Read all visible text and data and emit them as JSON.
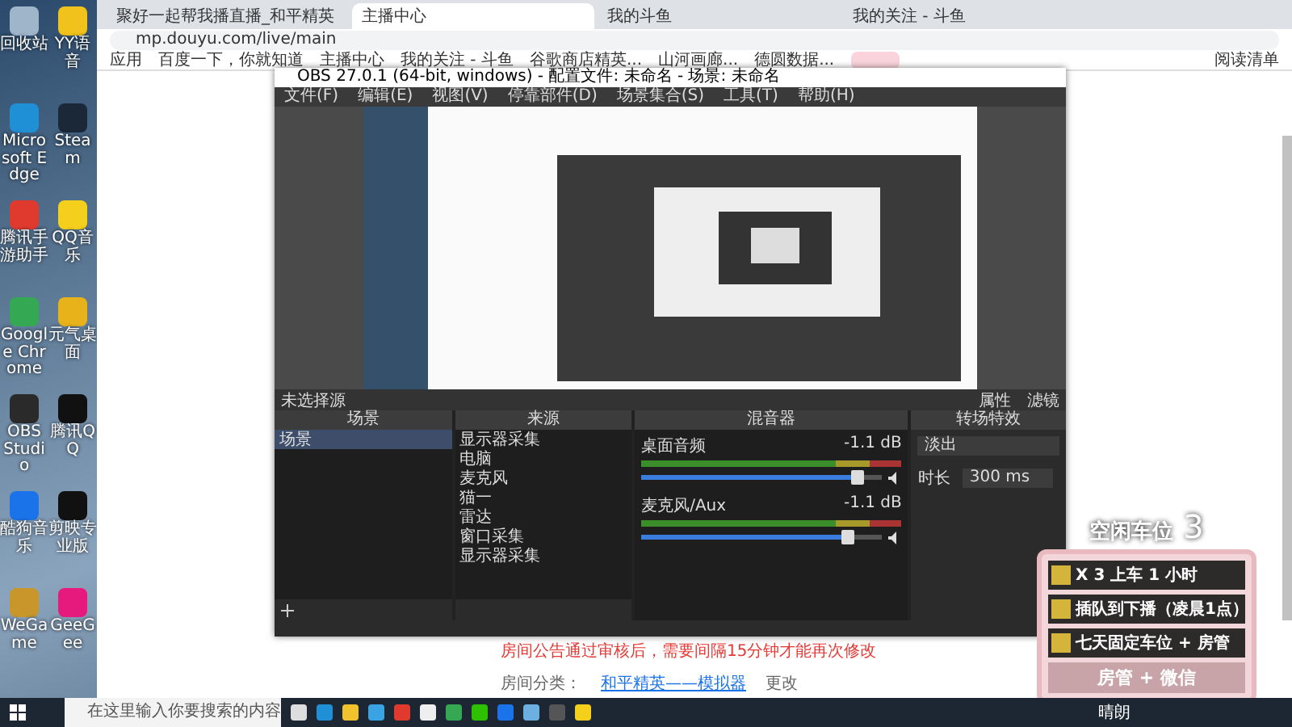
{
  "desktop_icons": [
    {
      "label": "回收站"
    },
    {
      "label": "YY语音"
    },
    {
      "label": "Microsoft Edge"
    },
    {
      "label": "Steam"
    },
    {
      "label": "腾讯手游助手"
    },
    {
      "label": "QQ音乐"
    },
    {
      "label": "Google Chrome"
    },
    {
      "label": "元气桌面"
    },
    {
      "label": "OBS Studio"
    },
    {
      "label": "腾讯QQ"
    },
    {
      "label": "酷狗音乐"
    },
    {
      "label": "剪映专业版"
    },
    {
      "label": "WeGame"
    },
    {
      "label": "GeeGee"
    }
  ],
  "browser": {
    "tabs": [
      {
        "label": "聚好一起帮我播直播_和平精英",
        "selected": false
      },
      {
        "label": "主播中心",
        "selected": true
      },
      {
        "label": "我的斗鱼",
        "selected": false
      },
      {
        "label": "我的关注 - 斗鱼",
        "selected": false
      }
    ],
    "url": "mp.douyu.com/live/main",
    "bookmarks": [
      {
        "label": "应用"
      },
      {
        "label": "百度一下，你就知道"
      },
      {
        "label": "主播中心"
      },
      {
        "label": "我的关注 - 斗鱼"
      },
      {
        "label": "谷歌商店精英..."
      },
      {
        "label": "山河画廊..."
      },
      {
        "label": "德圆数据..."
      }
    ],
    "reading_list": "阅读清单",
    "page": {
      "notice": "房间公告通过审核后，需要间隔15分钟才能再次修改",
      "category_label": "房间分类：",
      "category_value": "和平精英——模拟器",
      "change_link": "更改"
    }
  },
  "obs": {
    "title": "OBS 27.0.1 (64-bit, windows) - 配置文件: 未命名 - 场景: 未命名",
    "menu": [
      "文件(F)",
      "编辑(E)",
      "视图(V)",
      "停靠部件(D)",
      "场景集合(S)",
      "工具(T)",
      "帮助(H)"
    ],
    "no_source": "未选择源",
    "properties_button": "属性",
    "filters_button": "滤镜",
    "scenes": {
      "title": "场景",
      "items": [
        {
          "label": "场景",
          "selected": true
        }
      ]
    },
    "sources": {
      "title": "来源",
      "items": [
        {
          "label": "显示器采集"
        },
        {
          "label": "电脑"
        },
        {
          "label": "麦克风"
        },
        {
          "label": "猫一"
        },
        {
          "label": "雷达"
        },
        {
          "label": "窗口采集"
        },
        {
          "label": "显示器采集"
        }
      ]
    },
    "mixer": {
      "title": "混音器",
      "channels": [
        {
          "name": "桌面音频",
          "reading": "-1.1 dB",
          "level": 0.9
        },
        {
          "name": "麦克风/Aux",
          "reading": "-1.1 dB",
          "level": 0.86
        }
      ]
    },
    "transitions": {
      "title": "转场特效",
      "type": "淡出",
      "duration_label": "时长",
      "duration": "300 ms"
    }
  },
  "overlay": {
    "title": "空闲车位",
    "count": "3",
    "items": [
      {
        "label": "X 3 上车 1 小时"
      },
      {
        "label": "插队到下播（凌晨1点）"
      },
      {
        "label": "七天固定车位 + 房管"
      }
    ],
    "footer": "房管 + 微信"
  },
  "taskbar": {
    "search_placeholder": "在这里输入你要搜索的内容",
    "weather": "晴朗"
  }
}
